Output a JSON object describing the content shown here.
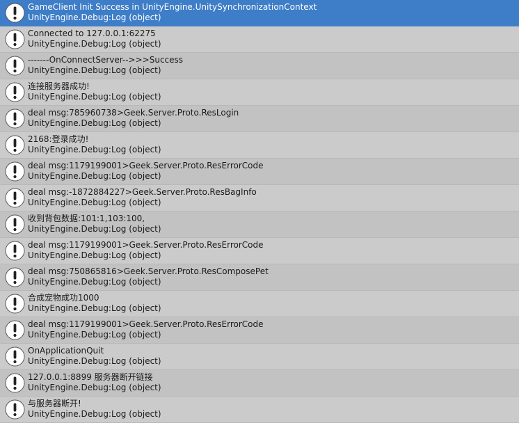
{
  "console": {
    "icon": "info-icon",
    "selected_index": 0,
    "colors": {
      "selected_bg": "#3e7dc7",
      "row_bg": "#c2c2c2",
      "row_alt_bg": "#cbcbcb",
      "text": "#1a1a1a",
      "selected_text": "#ffffff"
    },
    "entries": [
      {
        "message": "GameClient Init Success in UnityEngine.UnitySynchronizationContext",
        "source": "UnityEngine.Debug:Log (object)"
      },
      {
        "message": "Connected to 127.0.0.1:62275",
        "source": "UnityEngine.Debug:Log (object)"
      },
      {
        "message": "-------OnConnectServer-->>>Success",
        "source": "UnityEngine.Debug:Log (object)"
      },
      {
        "message": "连接服务器成功!",
        "source": "UnityEngine.Debug:Log (object)"
      },
      {
        "message": "deal msg:785960738>Geek.Server.Proto.ResLogin",
        "source": "UnityEngine.Debug:Log (object)"
      },
      {
        "message": "2168:登录成功!",
        "source": "UnityEngine.Debug:Log (object)"
      },
      {
        "message": "deal msg:1179199001>Geek.Server.Proto.ResErrorCode",
        "source": "UnityEngine.Debug:Log (object)"
      },
      {
        "message": "deal msg:-1872884227>Geek.Server.Proto.ResBagInfo",
        "source": "UnityEngine.Debug:Log (object)"
      },
      {
        "message": "收到背包数据:101:1,103:100,",
        "source": "UnityEngine.Debug:Log (object)"
      },
      {
        "message": "deal msg:1179199001>Geek.Server.Proto.ResErrorCode",
        "source": "UnityEngine.Debug:Log (object)"
      },
      {
        "message": "deal msg:750865816>Geek.Server.Proto.ResComposePet",
        "source": "UnityEngine.Debug:Log (object)"
      },
      {
        "message": "合成宠物成功1000",
        "source": "UnityEngine.Debug:Log (object)"
      },
      {
        "message": "deal msg:1179199001>Geek.Server.Proto.ResErrorCode",
        "source": "UnityEngine.Debug:Log (object)"
      },
      {
        "message": "OnApplicationQuit",
        "source": "UnityEngine.Debug:Log (object)"
      },
      {
        "message": "127.0.0.1:8899 服务器断开链接",
        "source": "UnityEngine.Debug:Log (object)"
      },
      {
        "message": "与服务器断开!",
        "source": "UnityEngine.Debug:Log (object)"
      }
    ]
  }
}
